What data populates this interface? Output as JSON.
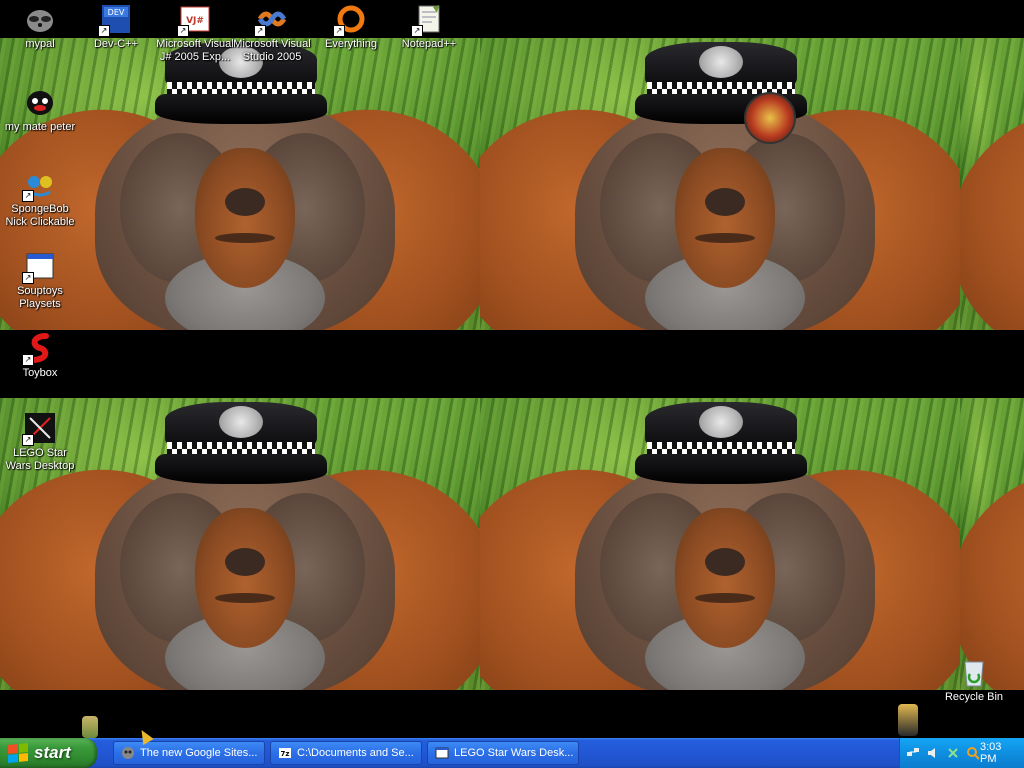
{
  "desktop": {
    "icons": [
      {
        "label": "mypal",
        "icon": "raccoon-icon"
      },
      {
        "label": "Dev-C++",
        "icon": "dev-cpp-icon"
      },
      {
        "label": "Microsoft Visual J# 2005 Exp...",
        "icon": "visual-jsharp-icon"
      },
      {
        "label": "Microsoft Visual Studio 2005",
        "icon": "visual-studio-icon"
      },
      {
        "label": "Everything",
        "icon": "everything-icon"
      },
      {
        "label": "Notepad++",
        "icon": "notepadpp-icon"
      },
      {
        "label": "my mate peter",
        "icon": "penguin-icon"
      },
      {
        "label": "SpongeBob Nick Clickable",
        "icon": "spongebob-icon"
      },
      {
        "label": "Souptoys Playsets",
        "icon": "window-icon"
      },
      {
        "label": "Toybox",
        "icon": "toybox-icon"
      },
      {
        "label": "LEGO Star Wars Desktop",
        "icon": "lightsaber-icon"
      },
      {
        "label": "Recycle Bin",
        "icon": "recycle-bin-icon"
      }
    ]
  },
  "taskbar": {
    "start_label": "start",
    "tasks": [
      {
        "label": "The new Google Sites...",
        "icon": "browser-icon"
      },
      {
        "label": "C:\\Documents and Se...",
        "icon": "7zip-icon"
      },
      {
        "label": "LEGO Star Wars Desk...",
        "icon": "window-icon"
      }
    ],
    "clock": "3:03 PM"
  },
  "colors": {
    "taskbar_blue": "#245edc",
    "start_green": "#3b9a3b",
    "tray_blue": "#0f8ee0"
  }
}
